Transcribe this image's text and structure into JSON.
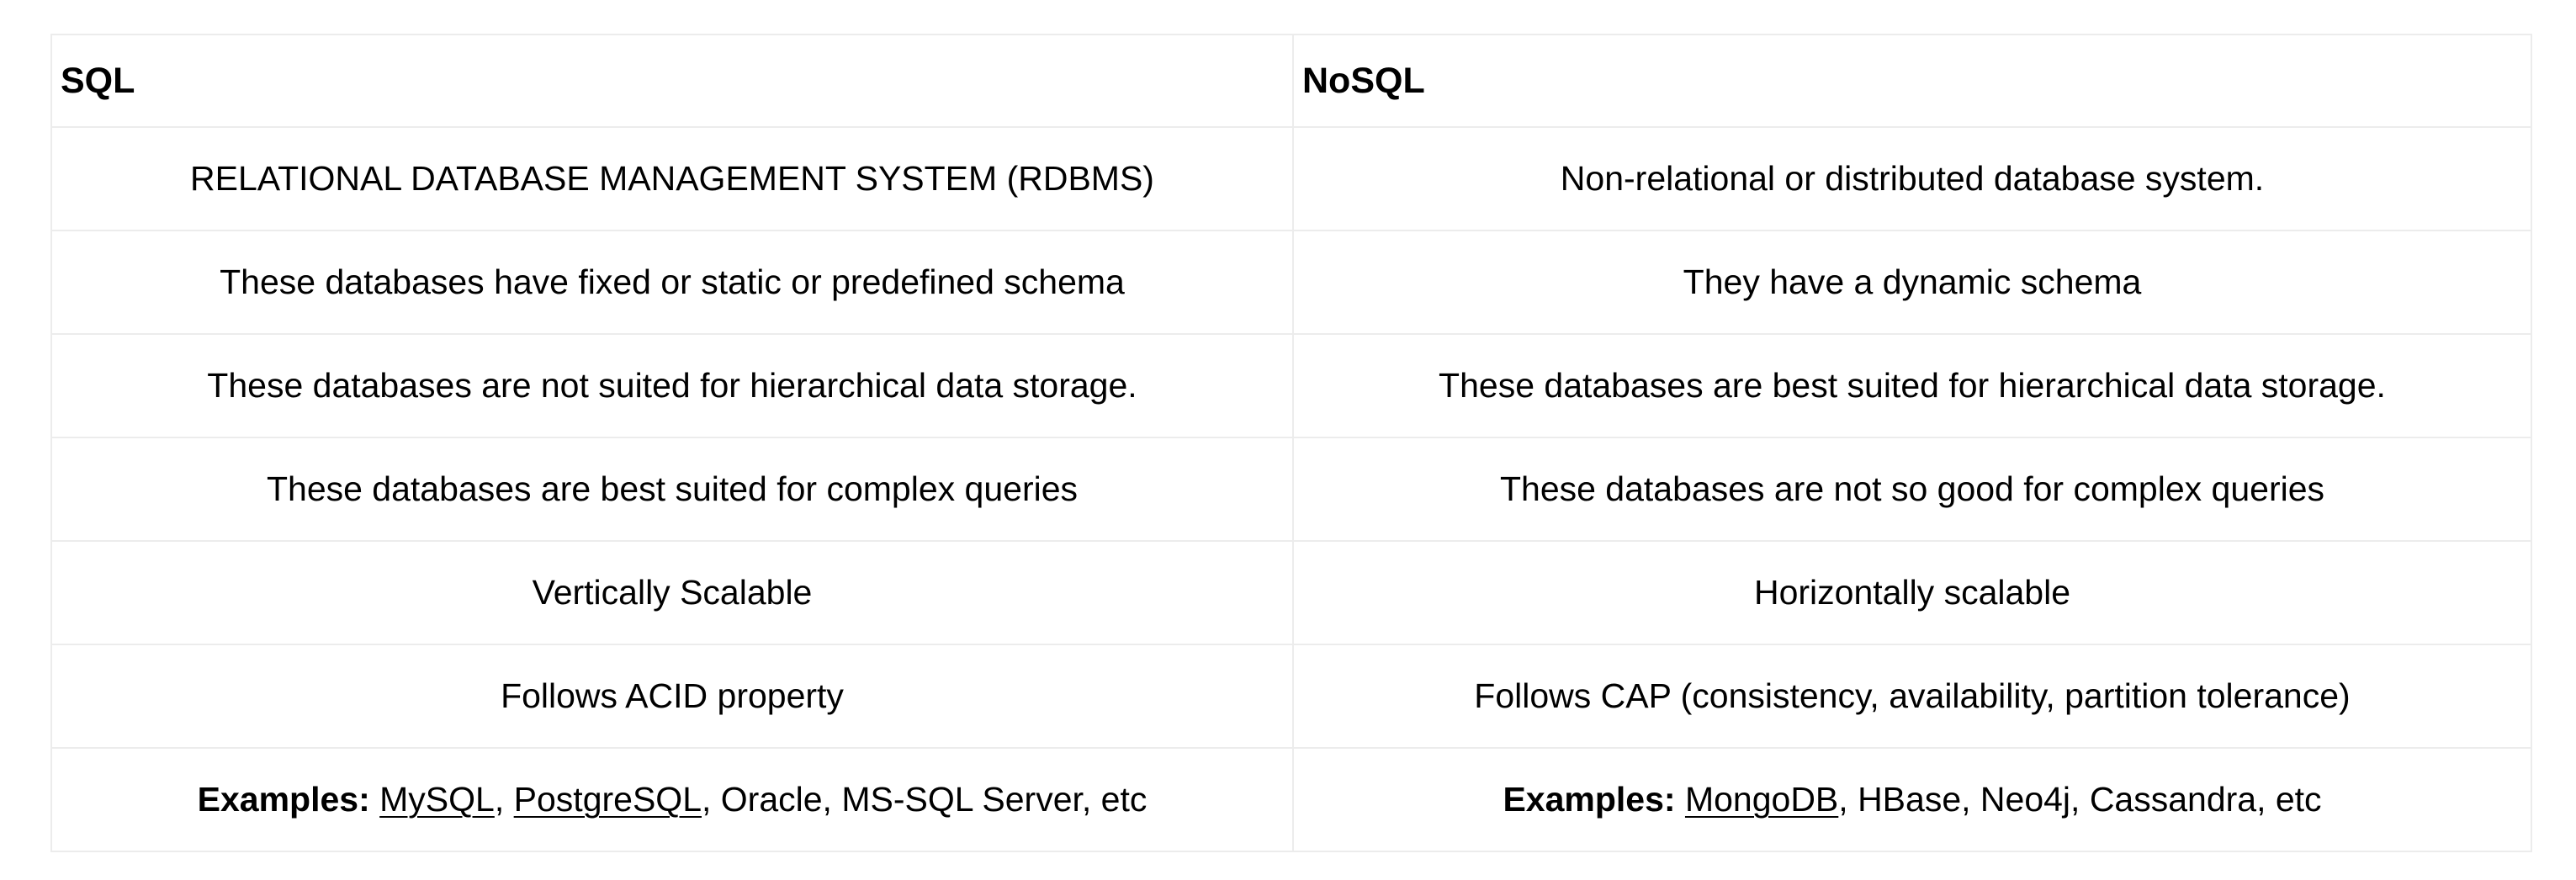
{
  "table": {
    "headers": [
      "SQL",
      "NoSQL"
    ],
    "rows": [
      [
        "RELATIONAL DATABASE MANAGEMENT SYSTEM (RDBMS)",
        "Non-relational or distributed database system."
      ],
      [
        "These databases have fixed or static or predefined schema",
        "They have a dynamic schema"
      ],
      [
        "These databases are not suited for hierarchical data storage.",
        "These databases are best suited for hierarchical data storage."
      ],
      [
        "These databases are best suited for complex queries",
        "These databases are not so good for complex queries"
      ],
      [
        "Vertically Scalable",
        "Horizontally scalable"
      ],
      [
        "Follows ACID property",
        "Follows CAP (consistency, availability, partition tolerance)"
      ]
    ],
    "examples": {
      "label": "Examples:",
      "sql": {
        "link1": "MySQL",
        "sep1": ", ",
        "link2": "PostgreSQL",
        "rest": ", Oracle, MS-SQL Server, etc"
      },
      "nosql": {
        "link1": "MongoDB",
        "rest": ", HBase, Neo4j, Cassandra, etc"
      }
    }
  },
  "colors": {
    "text": "#000000",
    "border": "#ececec",
    "background": "#ffffff"
  }
}
